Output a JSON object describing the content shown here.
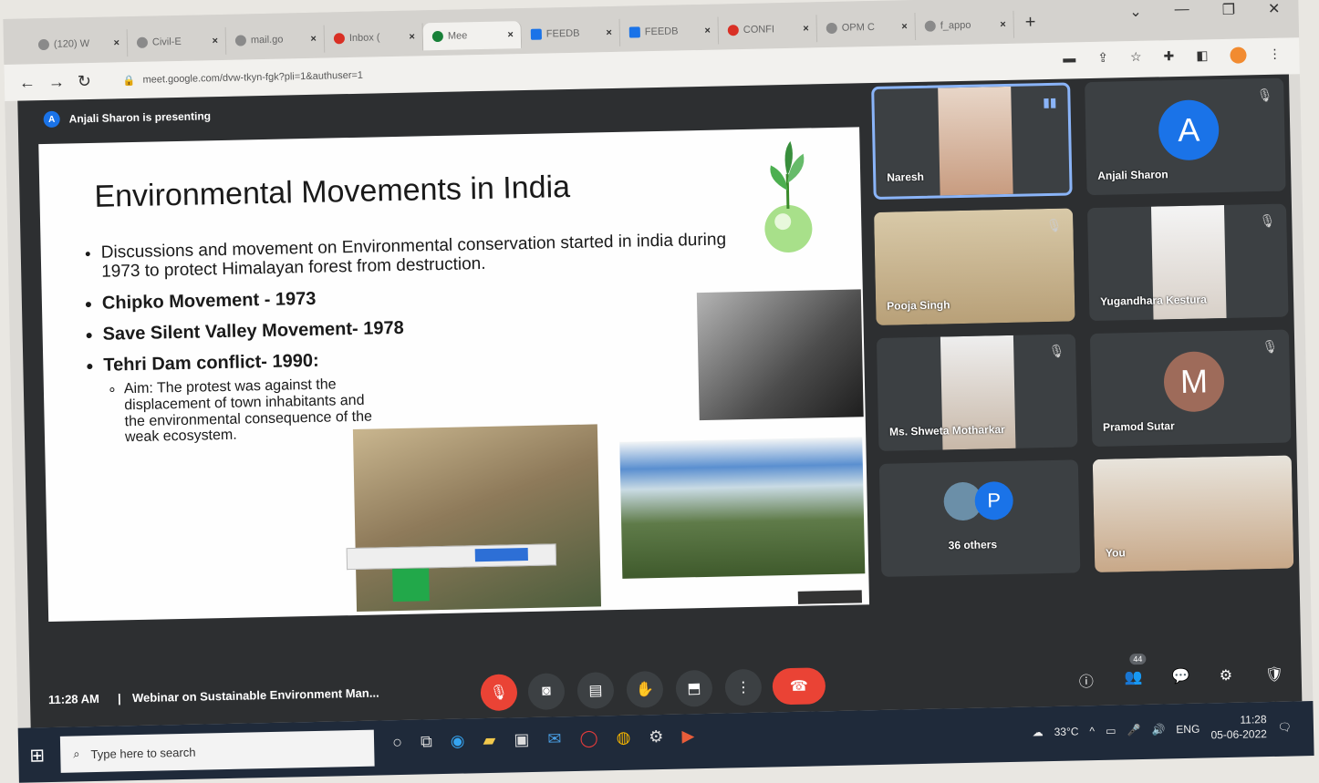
{
  "browser": {
    "tabs": [
      {
        "label": "(120) W",
        "active": false
      },
      {
        "label": "Civil-E",
        "active": false
      },
      {
        "label": "mail.go",
        "active": false
      },
      {
        "label": "Inbox (",
        "active": false
      },
      {
        "label": "Mee",
        "active": true
      },
      {
        "label": "FEEDB",
        "active": false
      },
      {
        "label": "FEEDB",
        "active": false
      },
      {
        "label": "CONFI",
        "active": false
      },
      {
        "label": "OPM C",
        "active": false
      },
      {
        "label": "f_appo",
        "active": false
      }
    ],
    "new_tab": "+",
    "url": "meet.google.com/dvw-tkyn-fgk?pli=1&authuser=1",
    "window_controls": [
      "⌄",
      "—",
      "❐",
      "✕"
    ]
  },
  "meet": {
    "presenting_text": "Anjali Sharon is presenting",
    "presenter_initial": "A",
    "slide": {
      "title": "Environmental Movements in India",
      "bullets": [
        {
          "text": "Discussions and movement on Environmental conservation started in india during 1973 to protect Himalayan forest from destruction.",
          "bold": false
        },
        {
          "text": "Chipko Movement - 1973",
          "bold": true
        },
        {
          "text": "Save Silent Valley Movement- 1978",
          "bold": true
        },
        {
          "text": "Tehri Dam conflict- 1990:",
          "bold": true
        }
      ],
      "sub_bullet": "Aim: The protest was against the displacement of town inhabitants and the environmental consequence of the weak ecosystem."
    },
    "participants": [
      {
        "name": "Naresh"
      },
      {
        "name": "Anjali Sharon",
        "initial": "A",
        "color": "#1a73e8"
      },
      {
        "name": "Pooja Singh"
      },
      {
        "name": "Yugandhara Kestura"
      },
      {
        "name": "Ms. Shweta Motharkar"
      },
      {
        "name": "Pramod Sutar",
        "initial": "M",
        "color": "#9e6b5a"
      },
      {
        "name": "36 others",
        "initial": "P",
        "color": "#1a73e8"
      },
      {
        "name": "You"
      }
    ],
    "bottom": {
      "time": "11:28 AM",
      "separator": "|",
      "meeting_title": "Webinar on Sustainable Environment Man...",
      "participant_count": "44"
    }
  },
  "taskbar": {
    "search_placeholder": "Type here to search",
    "temperature": "33°C",
    "language": "ENG",
    "time": "11:28",
    "date": "05-06-2022"
  }
}
